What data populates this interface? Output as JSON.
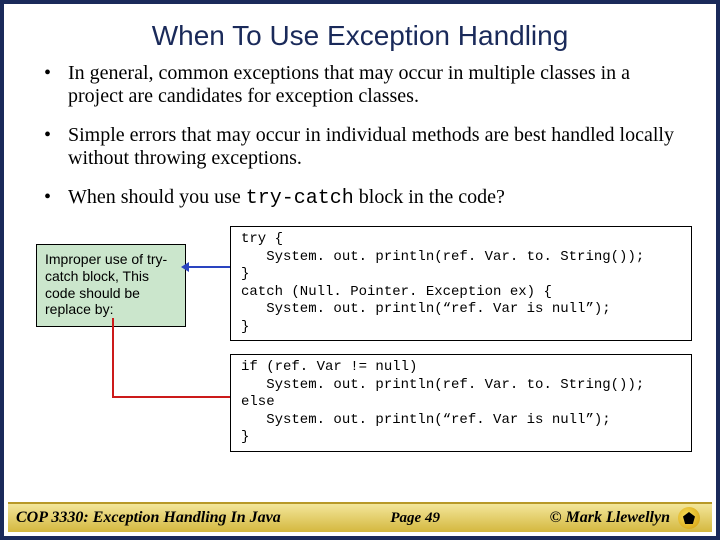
{
  "title": "When To Use Exception Handling",
  "bullets": {
    "b0": "In general, common exceptions that may occur in multiple classes in a project are candidates for exception classes.",
    "b1": "Simple errors that may occur in individual methods are best handled locally without throwing exceptions.",
    "b2_pre": "When should you use ",
    "b2_code": "try-catch",
    "b2_post": "  block in the code?"
  },
  "note": "Improper use of try-catch block,  This code should be replace by:",
  "code1": "try {\n   System. out. println(ref. Var. to. String());\n}\ncatch (Null. Pointer. Exception ex) {\n   System. out. println(“ref. Var is null”);\n}",
  "code2": "if (ref. Var != null)\n   System. out. println(ref. Var. to. String());\nelse\n   System. out. println(“ref. Var is null”);\n}",
  "footer": {
    "left": "COP 3330:  Exception Handling In Java",
    "page": "Page 49",
    "right": "© Mark Llewellyn"
  }
}
